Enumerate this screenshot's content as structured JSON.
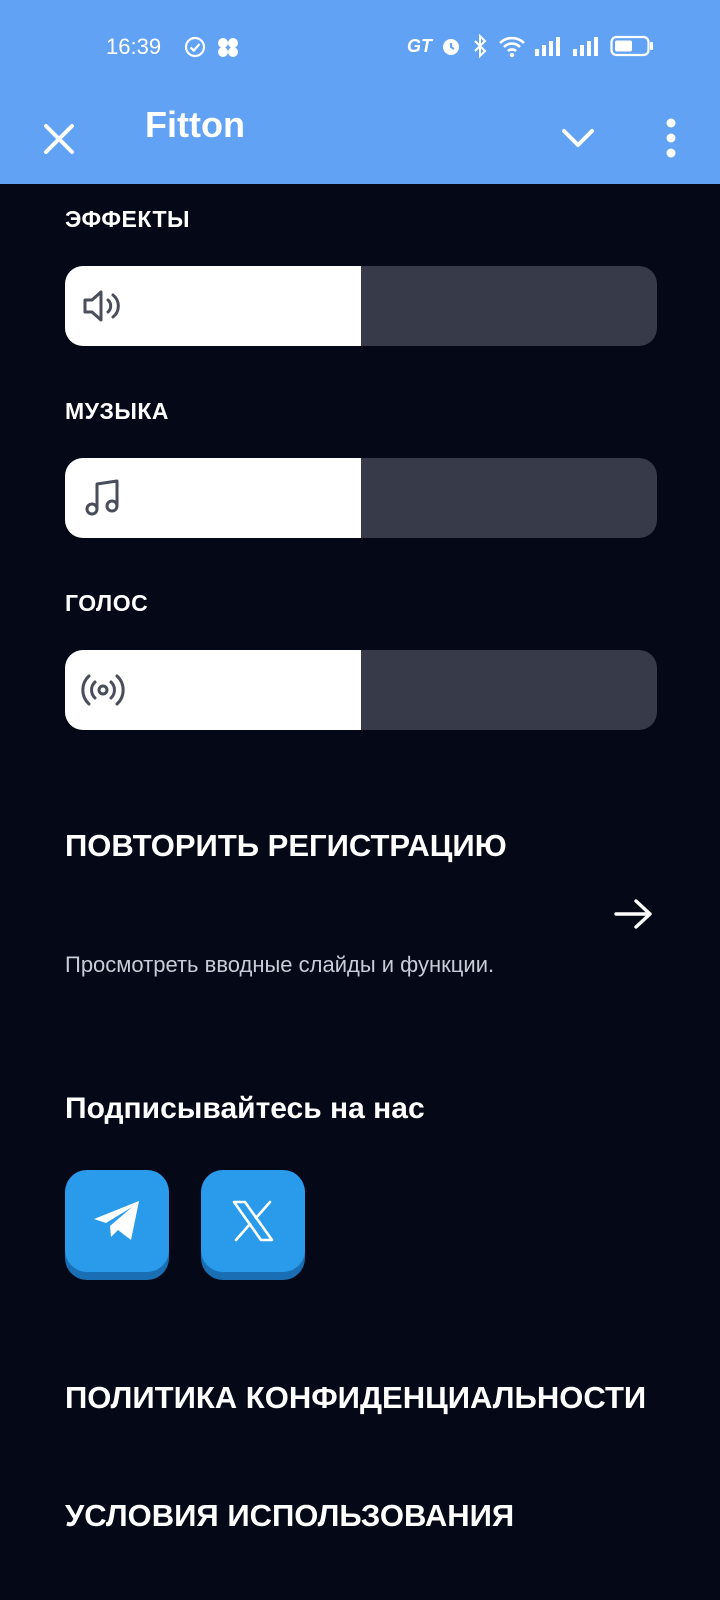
{
  "status_bar": {
    "time": "16:39",
    "right_text": "GT",
    "icons": [
      "check-circle-icon",
      "app-cluster-icon",
      "alarm-icon",
      "bluetooth-icon",
      "wifi-icon",
      "signal-icon",
      "signal-icon",
      "battery-icon"
    ]
  },
  "app_bar": {
    "title": "Fitton",
    "close_icon": "close-icon",
    "expand_icon": "chevron-down-icon",
    "menu_icon": "more-vertical-icon",
    "color": "#62a2f5"
  },
  "audio": {
    "effects": {
      "label": "ЭФФЕКТЫ",
      "icon": "speaker-icon",
      "level": 0.5
    },
    "music": {
      "label": "МУЗЫКА",
      "icon": "music-note-icon",
      "level": 0.5
    },
    "voice": {
      "label": "ГОЛОС",
      "icon": "broadcast-icon",
      "level": 0.5
    }
  },
  "repeat_registration": {
    "title": "ПОВТОРИТЬ РЕГИСТРАЦИЮ",
    "description": "Просмотреть вводные слайды и функции.",
    "icon": "arrow-right-icon"
  },
  "follow": {
    "title": "Подписывайтесь на нас",
    "buttons": [
      {
        "name": "telegram",
        "icon": "telegram-icon"
      },
      {
        "name": "x",
        "icon": "x-icon"
      }
    ],
    "button_color": "#2a9bea"
  },
  "links": {
    "privacy": "ПОЛИТИКА КОНФИДЕНЦИАЛЬНОСТИ",
    "terms": "УСЛОВИЯ ИСПОЛЬЗОВАНИЯ"
  },
  "colors": {
    "background": "#050816",
    "slider_track": "#373a48",
    "slider_fill": "#ffffff"
  }
}
